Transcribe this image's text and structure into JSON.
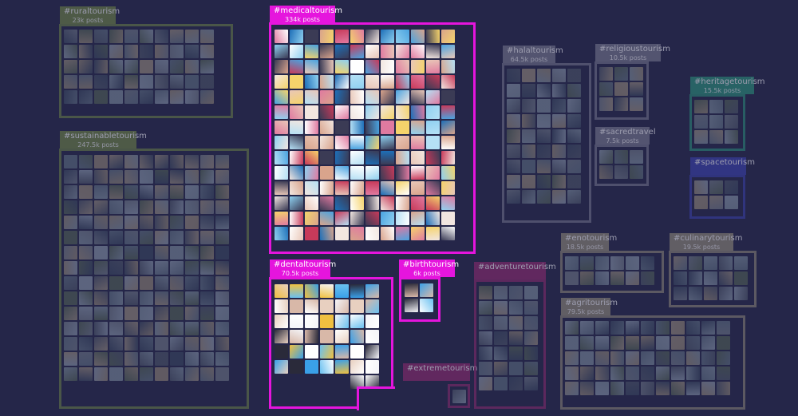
{
  "background": "#252649",
  "clusters": [
    {
      "id": "ruraltourism",
      "hashtag": "#ruraltourism",
      "posts": "23k posts",
      "color": "#6a7d47",
      "highlighted": false
    },
    {
      "id": "sustainabletourism",
      "hashtag": "#sustainabletourism",
      "posts": "247.5k posts",
      "color": "#6a7d47",
      "highlighted": false
    },
    {
      "id": "medicaltourism",
      "hashtag": "#medicaltourism",
      "posts": "334k posts",
      "color": "#e515dd",
      "highlighted": true
    },
    {
      "id": "dentaltourism",
      "hashtag": "#dentaltourism",
      "posts": "70.5k posts",
      "color": "#e515dd",
      "highlighted": true
    },
    {
      "id": "birthtourism",
      "hashtag": "#birthtourism",
      "posts": "6k posts",
      "color": "#e515dd",
      "highlighted": true
    },
    {
      "id": "extremetourism",
      "hashtag": "#extremetourism",
      "posts": "",
      "color": "#8a2a6e",
      "highlighted": false
    },
    {
      "id": "adventuretourism",
      "hashtag": "#adventuretourism",
      "posts": "",
      "color": "#8a2a6e",
      "highlighted": false
    },
    {
      "id": "halaltourism",
      "hashtag": "#halaltourism",
      "posts": "64.5k posts",
      "color": "#73738a",
      "highlighted": false
    },
    {
      "id": "religioustourism",
      "hashtag": "#religioustourism",
      "posts": "10.5k posts",
      "color": "#73738a",
      "highlighted": false
    },
    {
      "id": "sacredtravel",
      "hashtag": "#sacredtravel",
      "posts": "7.5k posts",
      "color": "#73738a",
      "highlighted": false
    },
    {
      "id": "heritagetourism",
      "hashtag": "#heritagetourism",
      "posts": "15.5k posts",
      "color": "#2b8a78",
      "highlighted": false
    },
    {
      "id": "spacetourism",
      "hashtag": "#spacetourism",
      "posts": "",
      "color": "#3a3fa8",
      "highlighted": false
    },
    {
      "id": "enotourism",
      "hashtag": "#enotourism",
      "posts": "18.5k posts",
      "color": "#8a8476",
      "highlighted": false
    },
    {
      "id": "culinarytourism",
      "hashtag": "#culinarytourism",
      "posts": "19.5k posts",
      "color": "#8a8476",
      "highlighted": false
    },
    {
      "id": "agritourism",
      "hashtag": "#agritourism",
      "posts": "79.5k posts",
      "color": "#8a8476",
      "highlighted": false
    }
  ]
}
